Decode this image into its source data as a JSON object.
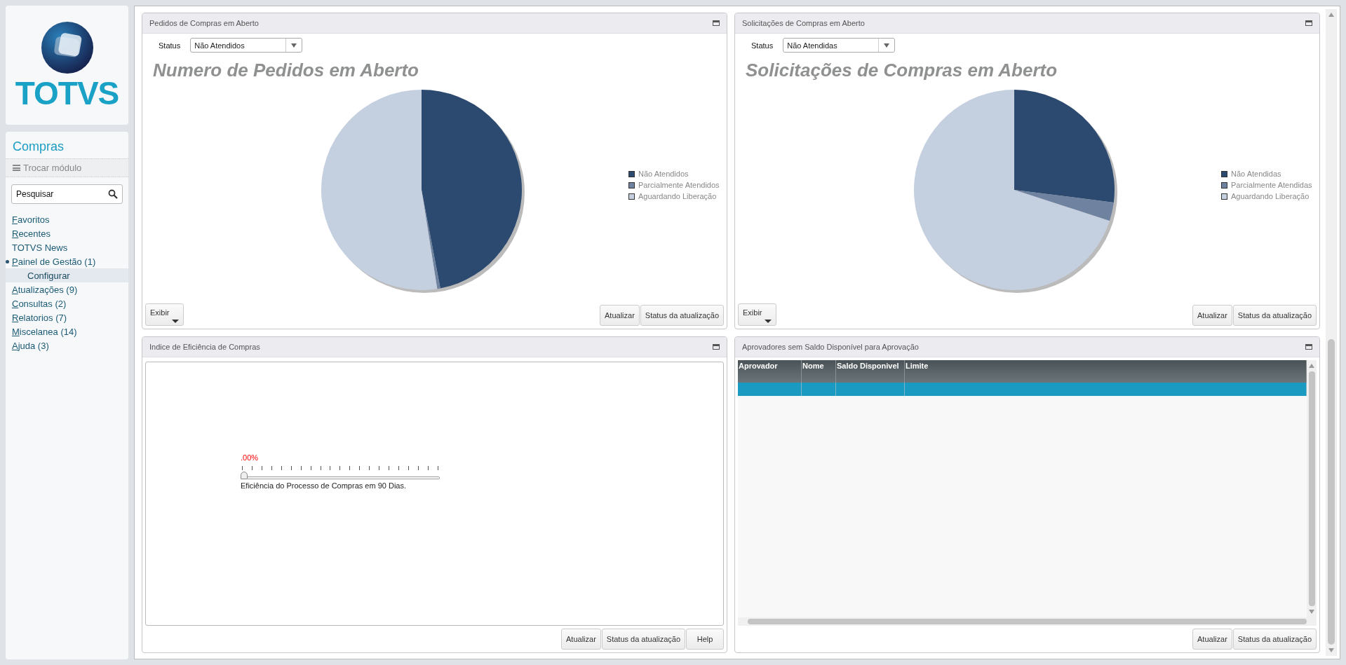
{
  "sidebar": {
    "brand": "TOTVS",
    "module": "Compras",
    "switch_module": "Trocar módulo",
    "search": {
      "placeholder": "Pesquisar"
    },
    "menu": [
      {
        "label": "Favoritos",
        "mnemonic": true,
        "bullet": false,
        "selected": false
      },
      {
        "label": "Recentes",
        "mnemonic": true,
        "bullet": false,
        "selected": false
      },
      {
        "label": "TOTVS News",
        "mnemonic": false,
        "bullet": false,
        "selected": false
      },
      {
        "label": "Painel de Gestão (1)",
        "mnemonic": true,
        "bullet": true,
        "selected": false,
        "children": [
          {
            "label": "Configurar",
            "mnemonic": false,
            "bullet": false,
            "selected": true
          }
        ]
      },
      {
        "label": "Atualizações (9)",
        "mnemonic": true,
        "bullet": false,
        "selected": false
      },
      {
        "label": "Consultas (2)",
        "mnemonic": true,
        "bullet": false,
        "selected": false
      },
      {
        "label": "Relatorios (7)",
        "mnemonic": true,
        "bullet": false,
        "selected": false
      },
      {
        "label": "Miscelanea (14)",
        "mnemonic": true,
        "bullet": false,
        "selected": false
      },
      {
        "label": "Ajuda (3)",
        "mnemonic": true,
        "bullet": false,
        "selected": false
      }
    ]
  },
  "panels": [
    {
      "kind": "pie",
      "title": "Pedidos de Compras em Aberto",
      "status_label": "Status",
      "status_value": "Não Atendidos",
      "heading": "Numero de Pedidos em Aberto",
      "legend": [
        {
          "label": "Não Atendidos",
          "color": "#2c4a70"
        },
        {
          "label": "Parcialmente Atendidos",
          "color": "#6f83a0"
        },
        {
          "label": "Aguardando Liberação",
          "color": "#c4cfe0"
        }
      ],
      "buttons": [
        {
          "label": "Exibir",
          "kind": "menu"
        },
        {
          "label": "Atualizar",
          "kind": "plain"
        },
        {
          "label": "Status da atualização",
          "kind": "plain"
        }
      ]
    },
    {
      "kind": "pie",
      "title": "Solicitações de Compras em Aberto",
      "status_label": "Status",
      "status_value": "Não Atendidas",
      "heading": "Solicitações de Compras em Aberto",
      "legend": [
        {
          "label": "Não Atendidas",
          "color": "#2c4a70"
        },
        {
          "label": "Parcialmente Atendidas",
          "color": "#6f83a0"
        },
        {
          "label": "Aguardando Liberação",
          "color": "#c4cfe0"
        }
      ],
      "buttons": [
        {
          "label": "Exibir",
          "kind": "menu"
        },
        {
          "label": "Atualizar",
          "kind": "plain"
        },
        {
          "label": "Status da atualização",
          "kind": "plain"
        }
      ]
    },
    {
      "kind": "gauge",
      "title": "Indice de Eficiência de Compras",
      "reading": ".00%",
      "level": 0,
      "caption": "Eficiência do Processo de Compras em 90 Dias.",
      "buttons": [
        {
          "label": "Atualizar",
          "kind": "plain"
        },
        {
          "label": "Status da atualização",
          "kind": "plain"
        },
        {
          "label": "Help",
          "kind": "plain"
        }
      ]
    },
    {
      "kind": "table",
      "title": "Aprovadores sem Saldo Disponível para Aprovação",
      "columns": [
        "Aprovador",
        "Nome",
        "Saldo Disponivel",
        "Limite"
      ],
      "rows": [
        {
          "selected": true
        }
      ],
      "buttons": [
        {
          "label": "Atualizar",
          "kind": "plain"
        },
        {
          "label": "Status da atualização",
          "kind": "plain"
        }
      ]
    }
  ]
}
